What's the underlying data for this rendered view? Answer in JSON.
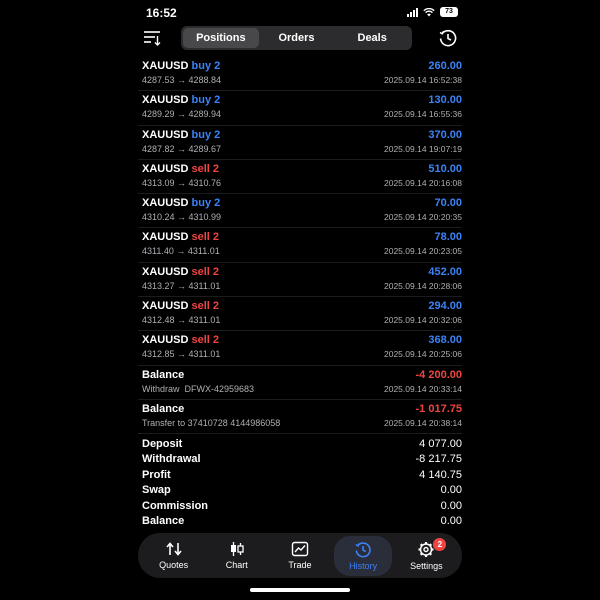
{
  "status_bar": {
    "time": "16:52",
    "battery": "73"
  },
  "header": {
    "tabs": [
      {
        "label": "Positions",
        "active": true
      },
      {
        "label": "Orders",
        "active": false
      },
      {
        "label": "Deals",
        "active": false
      }
    ]
  },
  "colors": {
    "buy": "#3b82f6",
    "sell": "#ef4444",
    "accent": "#3b82f6"
  },
  "deals": [
    {
      "symbol": "XAUUSD",
      "side": "buy 2",
      "side_type": "buy",
      "prices": "4287.53 → 4288.84",
      "profit": "260.00",
      "profit_sign": "pos",
      "time": "2025.09.14 16:52:38"
    },
    {
      "symbol": "XAUUSD",
      "side": "buy 2",
      "side_type": "buy",
      "prices": "4289.29 → 4289.94",
      "profit": "130.00",
      "profit_sign": "pos",
      "time": "2025.09.14 16:55:36"
    },
    {
      "symbol": "XAUUSD",
      "side": "buy 2",
      "side_type": "buy",
      "prices": "4287.82 → 4289.67",
      "profit": "370.00",
      "profit_sign": "pos",
      "time": "2025.09.14 19:07:19"
    },
    {
      "symbol": "XAUUSD",
      "side": "sell 2",
      "side_type": "sell",
      "prices": "4313.09 → 4310.76",
      "profit": "510.00",
      "profit_sign": "pos",
      "time": "2025.09.14 20:16:08"
    },
    {
      "symbol": "XAUUSD",
      "side": "buy 2",
      "side_type": "buy",
      "prices": "4310.24 → 4310.99",
      "profit": "70.00",
      "profit_sign": "pos",
      "time": "2025.09.14 20:20:35"
    },
    {
      "symbol": "XAUUSD",
      "side": "sell 2",
      "side_type": "sell",
      "prices": "4311.40 → 4311.01",
      "profit": "78.00",
      "profit_sign": "pos",
      "time": "2025.09.14 20:23:05"
    },
    {
      "symbol": "XAUUSD",
      "side": "sell 2",
      "side_type": "sell",
      "prices": "4313.27 → 4311.01",
      "profit": "452.00",
      "profit_sign": "pos",
      "time": "2025.09.14 20:28:06"
    },
    {
      "symbol": "XAUUSD",
      "side": "sell 2",
      "side_type": "sell",
      "prices": "4312.48 → 4311.01",
      "profit": "294.00",
      "profit_sign": "pos",
      "time": "2025.09.14 20:32:06"
    },
    {
      "symbol": "XAUUSD",
      "side": "sell 2",
      "side_type": "sell",
      "prices": "4312.85 → 4311.01",
      "profit": "368.00",
      "profit_sign": "pos",
      "time": "2025.09.14 20:25:06"
    }
  ],
  "balance_ops": [
    {
      "title": "Balance",
      "comment": "Withdraw  DFWX-42959683",
      "amount": "-4 200.00",
      "amount_sign": "neg",
      "time": "2025.09.14 20:33:14"
    },
    {
      "title": "Balance",
      "comment": "Transfer to 37410728 4144986058",
      "amount": "-1 017.75",
      "amount_sign": "neg",
      "time": "2025.09.14 20:38:14"
    }
  ],
  "summary": [
    {
      "label": "Deposit",
      "value": "4 077.00"
    },
    {
      "label": "Withdrawal",
      "value": "-8 217.75"
    },
    {
      "label": "Profit",
      "value": "4 140.75"
    },
    {
      "label": "Swap",
      "value": "0.00"
    },
    {
      "label": "Commission",
      "value": "0.00"
    },
    {
      "label": "Balance",
      "value": "0.00"
    }
  ],
  "tab_bar": {
    "items": [
      {
        "label": "Quotes",
        "icon": "quotes-arrows-icon",
        "active": false
      },
      {
        "label": "Chart",
        "icon": "candlestick-icon",
        "active": false
      },
      {
        "label": "Trade",
        "icon": "trade-chart-icon",
        "active": false
      },
      {
        "label": "History",
        "icon": "history-clock-icon",
        "active": true
      },
      {
        "label": "Settings",
        "icon": "gear-icon",
        "active": false
      }
    ],
    "settings_badge": "2"
  }
}
